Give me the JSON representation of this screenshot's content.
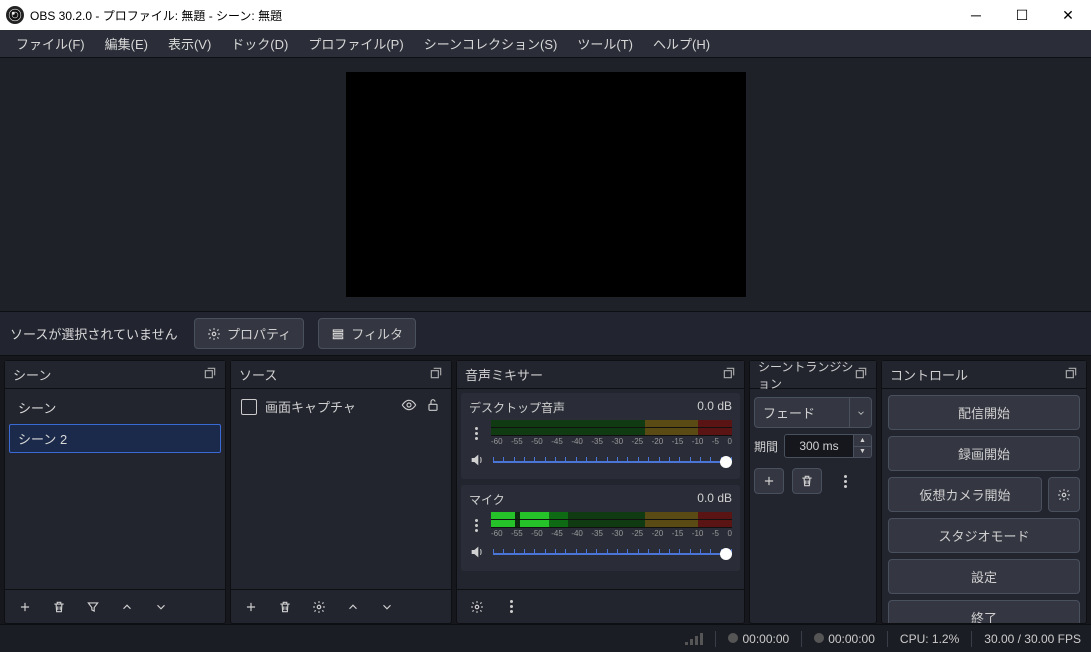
{
  "window": {
    "title": "OBS 30.2.0 - プロファイル: 無題 - シーン: 無題"
  },
  "menu": {
    "file": "ファイル(F)",
    "edit": "編集(E)",
    "view": "表示(V)",
    "dock": "ドック(D)",
    "profile": "プロファイル(P)",
    "scenecol": "シーンコレクション(S)",
    "tools": "ツール(T)",
    "help": "ヘルプ(H)"
  },
  "srcbar": {
    "msg": "ソースが選択されていません",
    "props": "プロパティ",
    "filters": "フィルタ"
  },
  "panels": {
    "scenes": {
      "title": "シーン",
      "items": [
        "シーン",
        "シーン 2"
      ],
      "selected": 1
    },
    "sources": {
      "title": "ソース",
      "items": [
        {
          "name": "画面キャプチャ"
        }
      ]
    },
    "mixer": {
      "title": "音声ミキサー",
      "channels": [
        {
          "name": "デスクトップ音声",
          "db": "0.0 dB"
        },
        {
          "name": "マイク",
          "db": "0.0 dB"
        }
      ],
      "scale": [
        "-60",
        "-55",
        "-50",
        "-45",
        "-40",
        "-35",
        "-30",
        "-25",
        "-20",
        "-15",
        "-10",
        "-5",
        "0"
      ]
    },
    "transitions": {
      "title": "シーントランジション",
      "selected": "フェード",
      "duration_label": "期間",
      "duration": "300 ms"
    },
    "controls": {
      "title": "コントロール",
      "stream": "配信開始",
      "record": "録画開始",
      "vcam": "仮想カメラ開始",
      "studio": "スタジオモード",
      "settings": "設定",
      "exit": "終了"
    }
  },
  "status": {
    "live_time": "00:00:00",
    "rec_time": "00:00:00",
    "cpu": "CPU: 1.2%",
    "fps": "30.00 / 30.00 FPS"
  }
}
